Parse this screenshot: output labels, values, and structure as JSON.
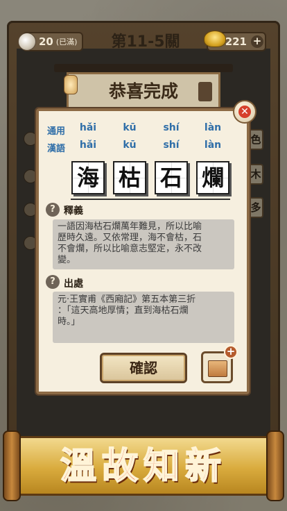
{
  "top_bar": {
    "bowls": "20",
    "bowls_status": "(已滿)",
    "level_title": "第11-5關",
    "gold": "221",
    "plus": "+"
  },
  "banner": {
    "title": "恭喜完成"
  },
  "side_tiles": [
    "色",
    "木",
    "多"
  ],
  "dialog": {
    "close_symbol": "✕",
    "pinyin_labels": {
      "common": "通用",
      "hanyu": "漢語"
    },
    "pinyin_common": [
      "hǎi",
      "kū",
      "shí",
      "làn"
    ],
    "pinyin_hanyu": [
      "hǎi",
      "kū",
      "shí",
      "làn"
    ],
    "idiom_chars": [
      "海",
      "枯",
      "石",
      "爛"
    ],
    "meaning_title": "釋義",
    "meaning_lines": [
      "一語因海枯石爛萬年難見，所以比喻",
      "歷時久遠。又依常理，海不會枯，石",
      "不會爛，所以比喻意志堅定，永不改",
      "變。"
    ],
    "source_title": "出處",
    "source_lines": [
      "元·王實甫《西廂記》第五本第三折",
      "：「這天高地厚情；直到海枯石爛",
      "時。」"
    ],
    "confirm_label": "確認",
    "book_plus": "+"
  },
  "bottom_banner": {
    "text": "溫故知新"
  },
  "colors": {
    "pinyin_blue": "#2f6ea8",
    "title_red": "#d83a1f",
    "scroll_gold": "#d9ab3d"
  }
}
